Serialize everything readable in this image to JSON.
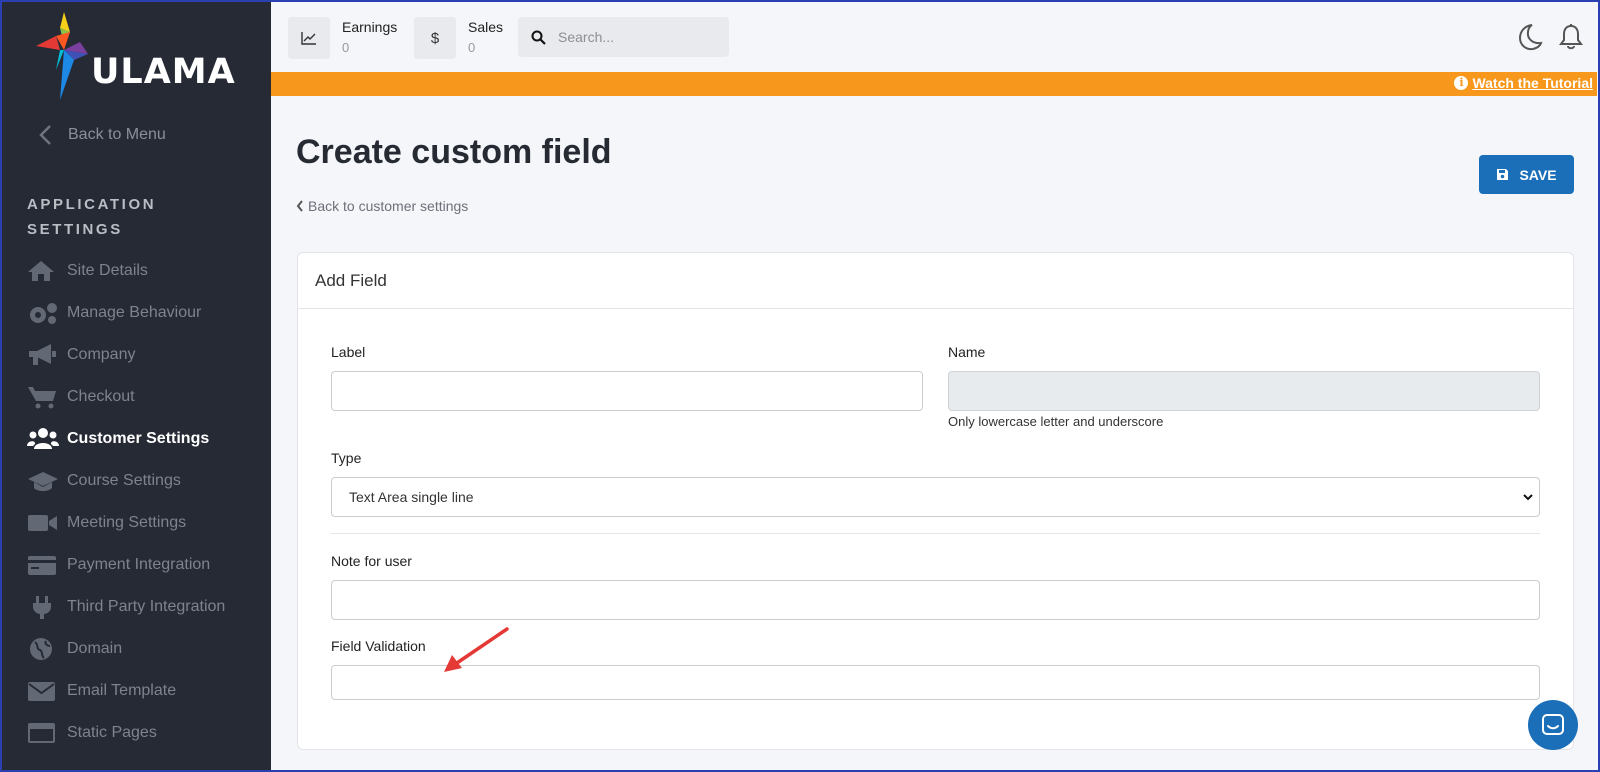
{
  "brand": {
    "name": "ULAMA"
  },
  "sidebar": {
    "back_label": "Back to Menu",
    "section_title": "APPLICATION SETTINGS",
    "items": [
      {
        "label": "Site Details",
        "icon": "home-icon",
        "active": false
      },
      {
        "label": "Manage Behaviour",
        "icon": "gears-icon",
        "active": false
      },
      {
        "label": "Company",
        "icon": "megaphone-icon",
        "active": false
      },
      {
        "label": "Checkout",
        "icon": "cart-icon",
        "active": false
      },
      {
        "label": "Customer Settings",
        "icon": "users-icon",
        "active": true
      },
      {
        "label": "Course Settings",
        "icon": "graduation-cap-icon",
        "active": false
      },
      {
        "label": "Meeting Settings",
        "icon": "video-icon",
        "active": false
      },
      {
        "label": "Payment Integration",
        "icon": "credit-card-icon",
        "active": false
      },
      {
        "label": "Third Party Integration",
        "icon": "plug-icon",
        "active": false
      },
      {
        "label": "Domain",
        "icon": "globe-icon",
        "active": false
      },
      {
        "label": "Email Template",
        "icon": "envelope-icon",
        "active": false
      },
      {
        "label": "Static Pages",
        "icon": "window-icon",
        "active": false
      }
    ]
  },
  "topbar": {
    "earnings": {
      "label": "Earnings",
      "value": "0"
    },
    "sales": {
      "label": "Sales",
      "value": "0",
      "symbol": "$"
    },
    "search_placeholder": "Search..."
  },
  "banner": {
    "tutorial_label": "Watch the Tutorial",
    "color": "#f7981d"
  },
  "page": {
    "title": "Create custom field",
    "back_link": "Back to customer settings",
    "save_label": "SAVE"
  },
  "form": {
    "card_title": "Add Field",
    "label_label": "Label",
    "label_value": "",
    "name_label": "Name",
    "name_value": "",
    "name_hint": "Only lowercase letter and underscore",
    "type_label": "Type",
    "type_value": "Text Area single line",
    "note_label": "Note for user",
    "note_value": "",
    "validation_label": "Field Validation",
    "validation_value": ""
  },
  "colors": {
    "accent": "#1a6fb8",
    "sidebar": "#252a35",
    "annotation_arrow": "#e53935"
  }
}
